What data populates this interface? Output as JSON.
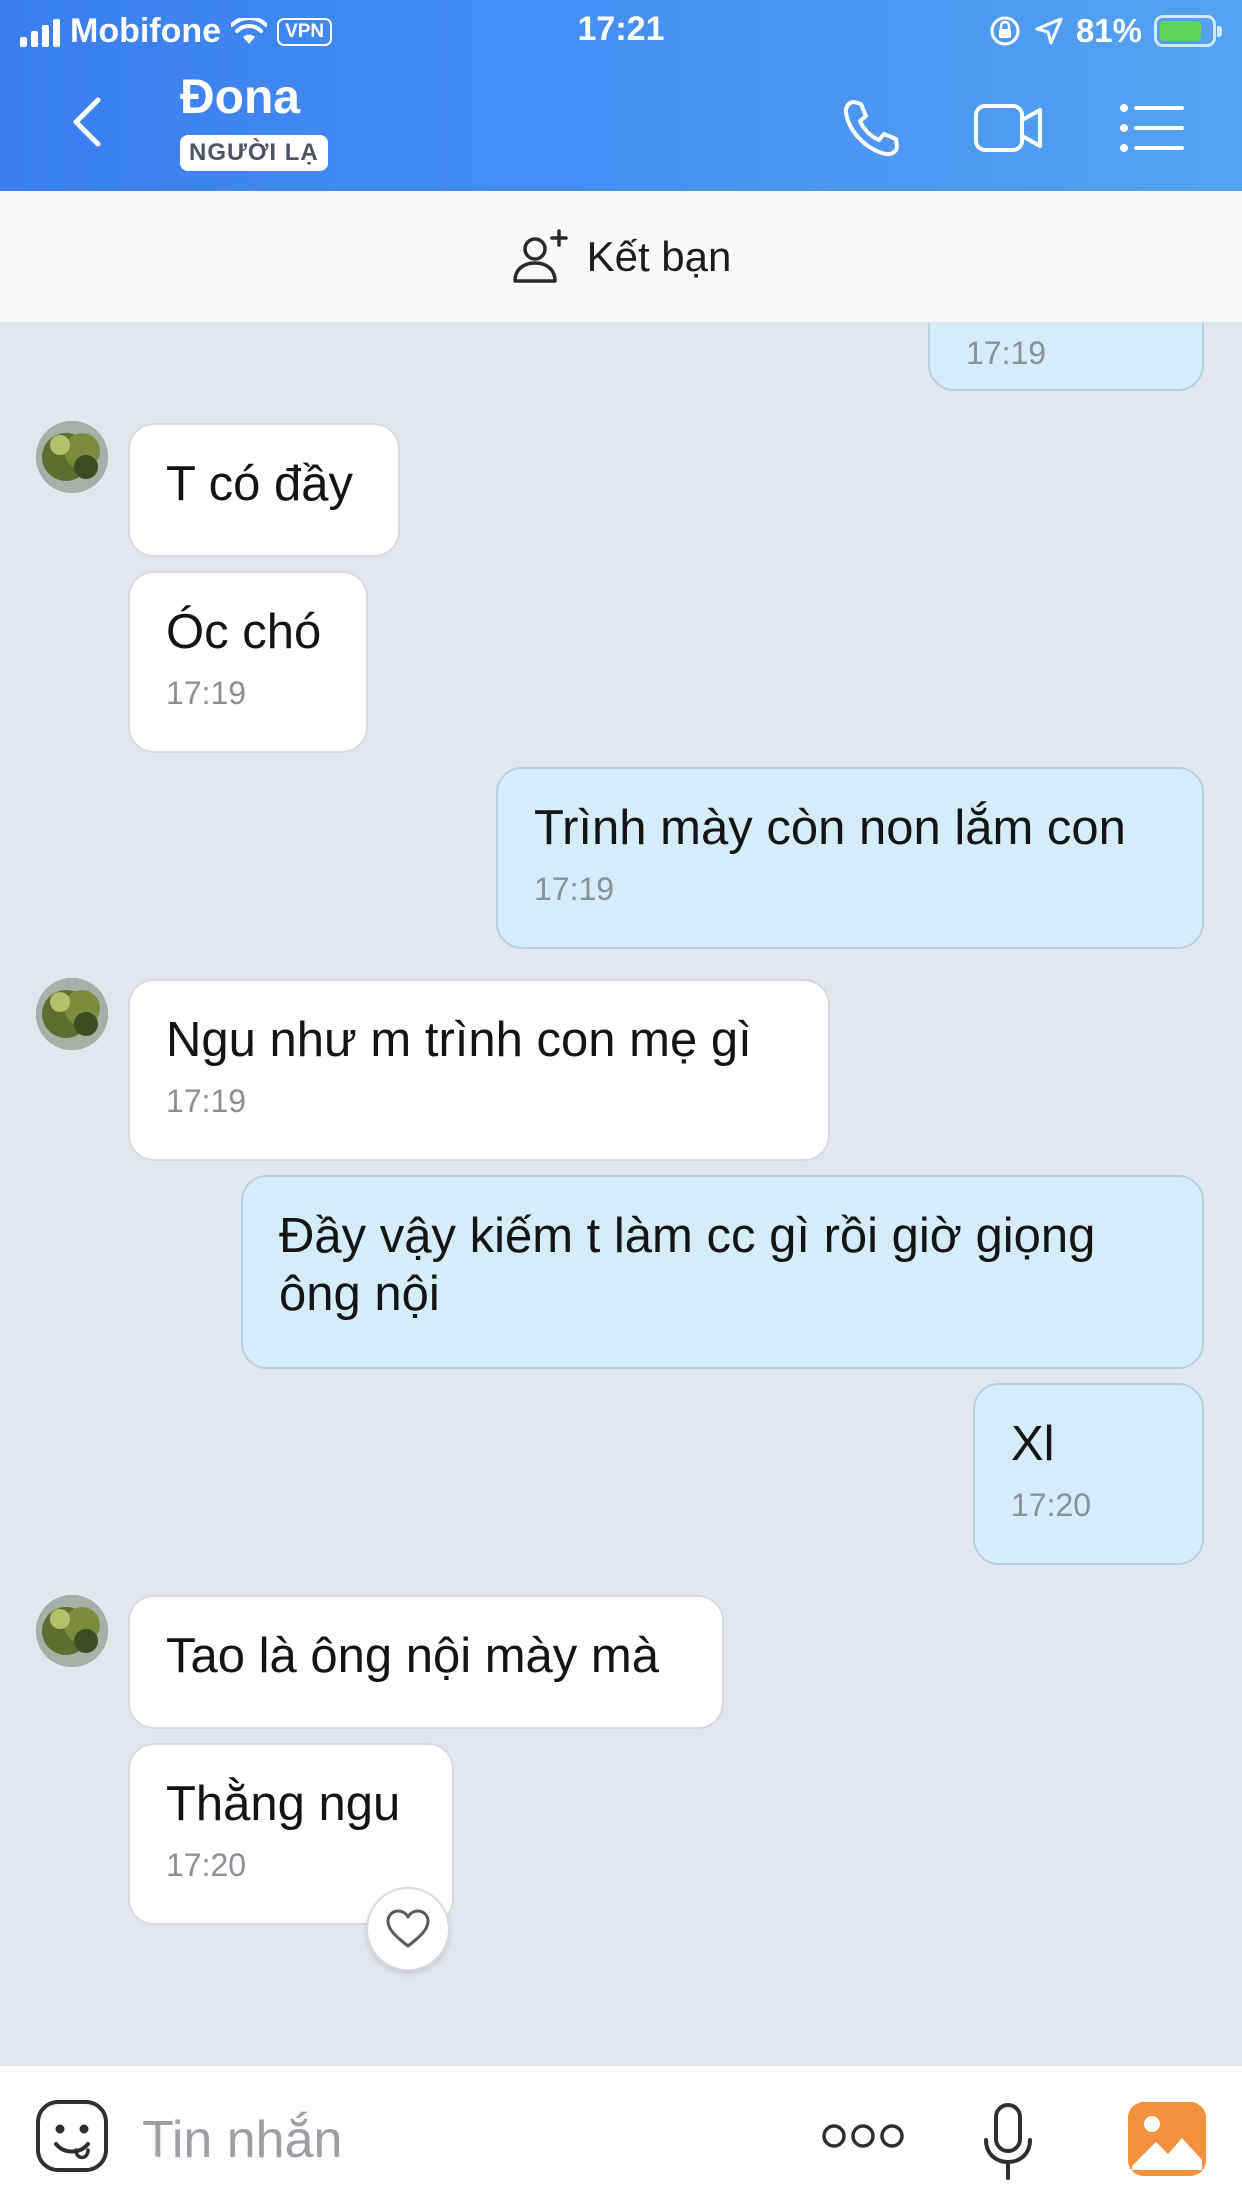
{
  "status_bar": {
    "carrier": "Mobifone",
    "vpn": "VPN",
    "time": "17:21",
    "battery_percent": "81%",
    "battery_level": 0.81
  },
  "header": {
    "contact_name": "Đona",
    "badge": "NGƯỜI LẠ"
  },
  "add_friend": {
    "label": "Kết bạn"
  },
  "messages": [
    {
      "direction": "out",
      "text": "",
      "time": "17:19"
    },
    {
      "direction": "in",
      "text": "T có đầy",
      "time": ""
    },
    {
      "direction": "in",
      "text": "Óc chó",
      "time": "17:19"
    },
    {
      "direction": "out",
      "text": "Trình mày còn non lắm con",
      "time": "17:19"
    },
    {
      "direction": "in",
      "text": "Ngu như m trình con mẹ gì",
      "time": "17:19"
    },
    {
      "direction": "out",
      "text": "Đầy vậy kiếm t làm cc gì rồi giờ giọng ông nội",
      "time": ""
    },
    {
      "direction": "out",
      "text": "Xl",
      "time": "17:20"
    },
    {
      "direction": "in",
      "text": "Tao là ông nội mày mà",
      "time": ""
    },
    {
      "direction": "in",
      "text": "Thằng ngu",
      "time": "17:20"
    }
  ],
  "input_bar": {
    "placeholder": "Tin nhắn"
  },
  "colors": {
    "header_blue": "#3a7ef0",
    "incoming_bubble": "#ffffff",
    "outgoing_bubble": "#d5ecfb",
    "chat_background": "#e2e6ee",
    "photo_button": "#f08a3a"
  }
}
